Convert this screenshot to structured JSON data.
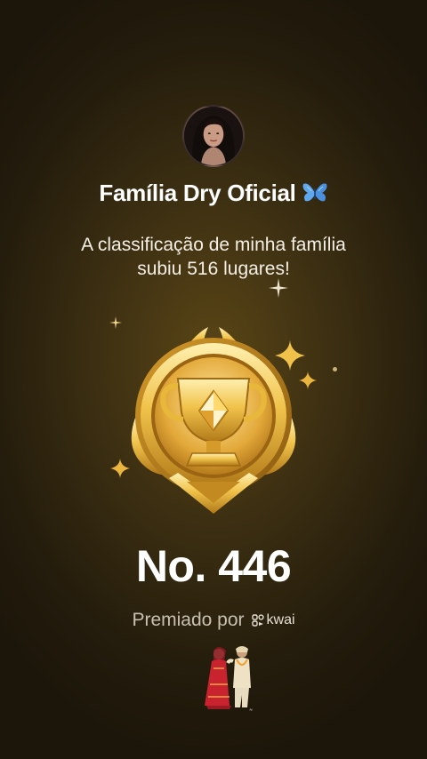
{
  "profile": {
    "name": "Família Dry Oficial",
    "name_icon": "butterfly-icon"
  },
  "headline": {
    "line1": "A classificação de minha família",
    "line2": "subiu 516 lugares!"
  },
  "badge": {
    "icon": "trophy-medal-icon"
  },
  "rank": {
    "text": "No. 446"
  },
  "footer": {
    "awarded_by": "Premiado por",
    "brand_name": "kwai"
  },
  "colors": {
    "gold": "#e8b83a",
    "background": "#3c2f12"
  }
}
